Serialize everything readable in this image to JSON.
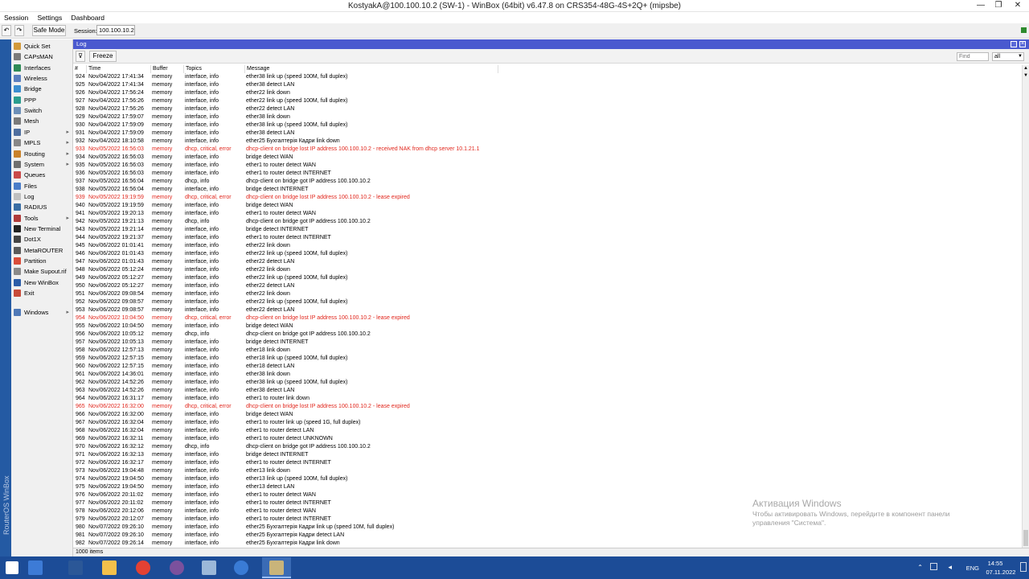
{
  "window": {
    "title": "KostyakA@100.100.10.2 (SW-1) - WinBox (64bit) v6.47.8 on CRS354-48G-4S+2Q+ (mipsbe)",
    "minimize": "—",
    "restore": "❐",
    "close": "✕"
  },
  "menubar": [
    "Session",
    "Settings",
    "Dashboard"
  ],
  "toolbar": {
    "undo": "↶",
    "redo": "↷",
    "safe_mode": "Safe Mode",
    "session_label": "Session:",
    "session_value": "100.100.10.2"
  },
  "sidebar": {
    "brand": "RouterOS WinBox",
    "items": [
      {
        "label": "Quick Set",
        "icon_color": "#d29a3a",
        "arrow": ""
      },
      {
        "label": "CAPsMAN",
        "icon_color": "#7b7b7b",
        "arrow": ""
      },
      {
        "label": "Interfaces",
        "icon_color": "#2e8b57",
        "arrow": ""
      },
      {
        "label": "Wireless",
        "icon_color": "#5a7fbf",
        "arrow": ""
      },
      {
        "label": "Bridge",
        "icon_color": "#3b8ed0",
        "arrow": ""
      },
      {
        "label": "PPP",
        "icon_color": "#2a9d8f",
        "arrow": ""
      },
      {
        "label": "Switch",
        "icon_color": "#6c8fb8",
        "arrow": ""
      },
      {
        "label": "Mesh",
        "icon_color": "#7a7a7a",
        "arrow": ""
      },
      {
        "label": "IP",
        "icon_color": "#4f6f9f",
        "arrow": "▸"
      },
      {
        "label": "MPLS",
        "icon_color": "#888888",
        "arrow": "▸"
      },
      {
        "label": "Routing",
        "icon_color": "#c9822b",
        "arrow": "▸"
      },
      {
        "label": "System",
        "icon_color": "#6f6f6f",
        "arrow": "▸"
      },
      {
        "label": "Queues",
        "icon_color": "#c94a4a",
        "arrow": ""
      },
      {
        "label": "Files",
        "icon_color": "#4a7dc9",
        "arrow": ""
      },
      {
        "label": "Log",
        "icon_color": "#bfbfbf",
        "arrow": ""
      },
      {
        "label": "RADIUS",
        "icon_color": "#3a6ea5",
        "arrow": ""
      },
      {
        "label": "Tools",
        "icon_color": "#b03a3a",
        "arrow": "▸"
      },
      {
        "label": "New Terminal",
        "icon_color": "#222222",
        "arrow": ""
      },
      {
        "label": "Dot1X",
        "icon_color": "#444444",
        "arrow": ""
      },
      {
        "label": "MetaROUTER",
        "icon_color": "#5a5a5a",
        "arrow": ""
      },
      {
        "label": "Partition",
        "icon_color": "#d94d3a",
        "arrow": ""
      },
      {
        "label": "Make Supout.rif",
        "icon_color": "#8a8a8a",
        "arrow": ""
      },
      {
        "label": "New WinBox",
        "icon_color": "#2b5da8",
        "arrow": ""
      },
      {
        "label": "Exit",
        "icon_color": "#c84b3a",
        "arrow": ""
      },
      {
        "label": "Windows",
        "icon_color": "#4f79b7",
        "arrow": "▸"
      }
    ]
  },
  "log": {
    "title": "Log",
    "filter_icon": "funnel-icon",
    "freeze": "Freeze",
    "find_placeholder": "Find",
    "find_scope": "all",
    "columns": [
      "#",
      "Time",
      "Buffer",
      "Topics",
      "Message"
    ],
    "status": "1000 items",
    "rows": [
      {
        "n": "924",
        "time": "Nov/04/2022 17:41:34",
        "buffer": "memory",
        "topics": "interface, info",
        "message": "ether38 link up (speed 100M, full duplex)"
      },
      {
        "n": "925",
        "time": "Nov/04/2022 17:41:34",
        "buffer": "memory",
        "topics": "interface, info",
        "message": "ether38 detect LAN"
      },
      {
        "n": "926",
        "time": "Nov/04/2022 17:56:24",
        "buffer": "memory",
        "topics": "interface, info",
        "message": "ether22 link down"
      },
      {
        "n": "927",
        "time": "Nov/04/2022 17:56:26",
        "buffer": "memory",
        "topics": "interface, info",
        "message": "ether22 link up (speed 100M, full duplex)"
      },
      {
        "n": "928",
        "time": "Nov/04/2022 17:56:26",
        "buffer": "memory",
        "topics": "interface, info",
        "message": "ether22 detect LAN"
      },
      {
        "n": "929",
        "time": "Nov/04/2022 17:59:07",
        "buffer": "memory",
        "topics": "interface, info",
        "message": "ether38 link down"
      },
      {
        "n": "930",
        "time": "Nov/04/2022 17:59:09",
        "buffer": "memory",
        "topics": "interface, info",
        "message": "ether38 link up (speed 100M, full duplex)"
      },
      {
        "n": "931",
        "time": "Nov/04/2022 17:59:09",
        "buffer": "memory",
        "topics": "interface, info",
        "message": "ether38 detect LAN"
      },
      {
        "n": "932",
        "time": "Nov/04/2022 18:10:58",
        "buffer": "memory",
        "topics": "interface, info",
        "message": "ether25    Бухгалтерія  Кадри  link down"
      },
      {
        "n": "933",
        "time": "Nov/05/2022 16:56:03",
        "buffer": "memory",
        "topics": "dhcp, critical, error",
        "message": "dhcp-client on bridge lost IP address 100.100.10.2 - received NAK from dhcp server 10.1.21.1",
        "error": true
      },
      {
        "n": "934",
        "time": "Nov/05/2022 16:56:03",
        "buffer": "memory",
        "topics": "interface, info",
        "message": "bridge detect WAN"
      },
      {
        "n": "935",
        "time": "Nov/05/2022 16:56:03",
        "buffer": "memory",
        "topics": "interface, info",
        "message": "ether1 to router detect WAN"
      },
      {
        "n": "936",
        "time": "Nov/05/2022 16:56:03",
        "buffer": "memory",
        "topics": "interface, info",
        "message": "ether1 to router detect INTERNET"
      },
      {
        "n": "937",
        "time": "Nov/05/2022 16:56:04",
        "buffer": "memory",
        "topics": "dhcp, info",
        "message": "dhcp-client on bridge got IP address 100.100.10.2"
      },
      {
        "n": "938",
        "time": "Nov/05/2022 16:56:04",
        "buffer": "memory",
        "topics": "interface, info",
        "message": "bridge detect INTERNET"
      },
      {
        "n": "939",
        "time": "Nov/05/2022 19:19:59",
        "buffer": "memory",
        "topics": "dhcp, critical, error",
        "message": "dhcp-client on bridge lost IP address 100.100.10.2 - lease expired",
        "error": true
      },
      {
        "n": "940",
        "time": "Nov/05/2022 19:19:59",
        "buffer": "memory",
        "topics": "interface, info",
        "message": "bridge detect WAN"
      },
      {
        "n": "941",
        "time": "Nov/05/2022 19:20:13",
        "buffer": "memory",
        "topics": "interface, info",
        "message": "ether1 to router detect WAN"
      },
      {
        "n": "942",
        "time": "Nov/05/2022 19:21:13",
        "buffer": "memory",
        "topics": "dhcp, info",
        "message": "dhcp-client on bridge got IP address 100.100.10.2"
      },
      {
        "n": "943",
        "time": "Nov/05/2022 19:21:14",
        "buffer": "memory",
        "topics": "interface, info",
        "message": "bridge detect INTERNET"
      },
      {
        "n": "944",
        "time": "Nov/05/2022 19:21:37",
        "buffer": "memory",
        "topics": "interface, info",
        "message": "ether1 to router detect INTERNET"
      },
      {
        "n": "945",
        "time": "Nov/06/2022 01:01:41",
        "buffer": "memory",
        "topics": "interface, info",
        "message": "ether22 link down"
      },
      {
        "n": "946",
        "time": "Nov/06/2022 01:01:43",
        "buffer": "memory",
        "topics": "interface, info",
        "message": "ether22 link up (speed 100M, full duplex)"
      },
      {
        "n": "947",
        "time": "Nov/06/2022 01:01:43",
        "buffer": "memory",
        "topics": "interface, info",
        "message": "ether22 detect LAN"
      },
      {
        "n": "948",
        "time": "Nov/06/2022 05:12:24",
        "buffer": "memory",
        "topics": "interface, info",
        "message": "ether22 link down"
      },
      {
        "n": "949",
        "time": "Nov/06/2022 05:12:27",
        "buffer": "memory",
        "topics": "interface, info",
        "message": "ether22 link up (speed 100M, full duplex)"
      },
      {
        "n": "950",
        "time": "Nov/06/2022 05:12:27",
        "buffer": "memory",
        "topics": "interface, info",
        "message": "ether22 detect LAN"
      },
      {
        "n": "951",
        "time": "Nov/06/2022 09:08:54",
        "buffer": "memory",
        "topics": "interface, info",
        "message": "ether22 link down"
      },
      {
        "n": "952",
        "time": "Nov/06/2022 09:08:57",
        "buffer": "memory",
        "topics": "interface, info",
        "message": "ether22 link up (speed 100M, full duplex)"
      },
      {
        "n": "953",
        "time": "Nov/06/2022 09:08:57",
        "buffer": "memory",
        "topics": "interface, info",
        "message": "ether22 detect LAN"
      },
      {
        "n": "954",
        "time": "Nov/06/2022 10:04:50",
        "buffer": "memory",
        "topics": "dhcp, critical, error",
        "message": "dhcp-client on bridge lost IP address 100.100.10.2 - lease expired",
        "error": true
      },
      {
        "n": "955",
        "time": "Nov/06/2022 10:04:50",
        "buffer": "memory",
        "topics": "interface, info",
        "message": "bridge detect WAN"
      },
      {
        "n": "956",
        "time": "Nov/06/2022 10:05:12",
        "buffer": "memory",
        "topics": "dhcp, info",
        "message": "dhcp-client on bridge got IP address 100.100.10.2"
      },
      {
        "n": "957",
        "time": "Nov/06/2022 10:05:13",
        "buffer": "memory",
        "topics": "interface, info",
        "message": "bridge detect INTERNET"
      },
      {
        "n": "958",
        "time": "Nov/06/2022 12:57:13",
        "buffer": "memory",
        "topics": "interface, info",
        "message": "ether18 link down"
      },
      {
        "n": "959",
        "time": "Nov/06/2022 12:57:15",
        "buffer": "memory",
        "topics": "interface, info",
        "message": "ether18 link up (speed 100M, full duplex)"
      },
      {
        "n": "960",
        "time": "Nov/06/2022 12:57:15",
        "buffer": "memory",
        "topics": "interface, info",
        "message": "ether18 detect LAN"
      },
      {
        "n": "961",
        "time": "Nov/06/2022 14:36:01",
        "buffer": "memory",
        "topics": "interface, info",
        "message": "ether38 link down"
      },
      {
        "n": "962",
        "time": "Nov/06/2022 14:52:26",
        "buffer": "memory",
        "topics": "interface, info",
        "message": "ether38 link up (speed 100M, full duplex)"
      },
      {
        "n": "963",
        "time": "Nov/06/2022 14:52:26",
        "buffer": "memory",
        "topics": "interface, info",
        "message": "ether38 detect LAN"
      },
      {
        "n": "964",
        "time": "Nov/06/2022 16:31:17",
        "buffer": "memory",
        "topics": "interface, info",
        "message": "ether1 to router link down"
      },
      {
        "n": "965",
        "time": "Nov/06/2022 16:32:00",
        "buffer": "memory",
        "topics": "dhcp, critical, error",
        "message": "dhcp-client on bridge lost IP address 100.100.10.2 - lease expired",
        "error": true
      },
      {
        "n": "966",
        "time": "Nov/06/2022 16:32:00",
        "buffer": "memory",
        "topics": "interface, info",
        "message": "bridge detect WAN"
      },
      {
        "n": "967",
        "time": "Nov/06/2022 16:32:04",
        "buffer": "memory",
        "topics": "interface, info",
        "message": "ether1 to router link up (speed 1G, full duplex)"
      },
      {
        "n": "968",
        "time": "Nov/06/2022 16:32:04",
        "buffer": "memory",
        "topics": "interface, info",
        "message": "ether1 to router detect LAN"
      },
      {
        "n": "969",
        "time": "Nov/06/2022 16:32:11",
        "buffer": "memory",
        "topics": "interface, info",
        "message": "ether1 to router detect UNKNOWN"
      },
      {
        "n": "970",
        "time": "Nov/06/2022 16:32:12",
        "buffer": "memory",
        "topics": "dhcp, info",
        "message": "dhcp-client on bridge got IP address 100.100.10.2"
      },
      {
        "n": "971",
        "time": "Nov/06/2022 16:32:13",
        "buffer": "memory",
        "topics": "interface, info",
        "message": "bridge detect INTERNET"
      },
      {
        "n": "972",
        "time": "Nov/06/2022 16:32:17",
        "buffer": "memory",
        "topics": "interface, info",
        "message": "ether1 to router detect INTERNET"
      },
      {
        "n": "973",
        "time": "Nov/06/2022 19:04:48",
        "buffer": "memory",
        "topics": "interface, info",
        "message": "ether13 link down"
      },
      {
        "n": "974",
        "time": "Nov/06/2022 19:04:50",
        "buffer": "memory",
        "topics": "interface, info",
        "message": "ether13 link up (speed 100M, full duplex)"
      },
      {
        "n": "975",
        "time": "Nov/06/2022 19:04:50",
        "buffer": "memory",
        "topics": "interface, info",
        "message": "ether13 detect LAN"
      },
      {
        "n": "976",
        "time": "Nov/06/2022 20:11:02",
        "buffer": "memory",
        "topics": "interface, info",
        "message": "ether1 to router detect WAN"
      },
      {
        "n": "977",
        "time": "Nov/06/2022 20:11:02",
        "buffer": "memory",
        "topics": "interface, info",
        "message": "ether1 to router detect INTERNET"
      },
      {
        "n": "978",
        "time": "Nov/06/2022 20:12:06",
        "buffer": "memory",
        "topics": "interface, info",
        "message": "ether1 to router detect WAN"
      },
      {
        "n": "979",
        "time": "Nov/06/2022 20:12:07",
        "buffer": "memory",
        "topics": "interface, info",
        "message": "ether1 to router detect INTERNET"
      },
      {
        "n": "980",
        "time": "Nov/07/2022 09:26:10",
        "buffer": "memory",
        "topics": "interface, info",
        "message": "ether25    Бухгалтерія  Кадри  link up (speed 10M, full duplex)"
      },
      {
        "n": "981",
        "time": "Nov/07/2022 09:26:10",
        "buffer": "memory",
        "topics": "interface, info",
        "message": "ether25    Бухгалтерія  Кадри  detect LAN"
      },
      {
        "n": "982",
        "time": "Nov/07/2022 09:26:14",
        "buffer": "memory",
        "topics": "interface, info",
        "message": "ether25    Бухгалтерія  Кадри  link down"
      }
    ]
  },
  "watermark": {
    "line1": "Активация Windows",
    "line2": "Чтобы активировать Windows, перейдите в компонент панели",
    "line3": "управления \"Система\"."
  },
  "taskbar": {
    "apps": [
      {
        "name": "start-button",
        "color": "#ffffff"
      },
      {
        "name": "server-manager-icon",
        "color": "#3d7bd6"
      },
      {
        "name": "powershell-icon",
        "color": "#2b5797"
      },
      {
        "name": "file-explorer-icon",
        "color": "#f3c04b"
      },
      {
        "name": "chrome-icon",
        "color": "#e34133"
      },
      {
        "name": "viber-icon",
        "color": "#7b519d"
      },
      {
        "name": "settings-tool-icon",
        "color": "#9bb8d9"
      },
      {
        "name": "remote-desktop-icon",
        "color": "#3a7bd5"
      },
      {
        "name": "winbox-icon",
        "color": "#c9b47a"
      }
    ],
    "lang": "ENG",
    "time": "14:55",
    "date": "07.11.2022"
  },
  "colors": {
    "accent": "#4a59cf",
    "sidebar": "#245aa3",
    "taskbar": "#1c4c97",
    "error_text": "#e1261c"
  }
}
